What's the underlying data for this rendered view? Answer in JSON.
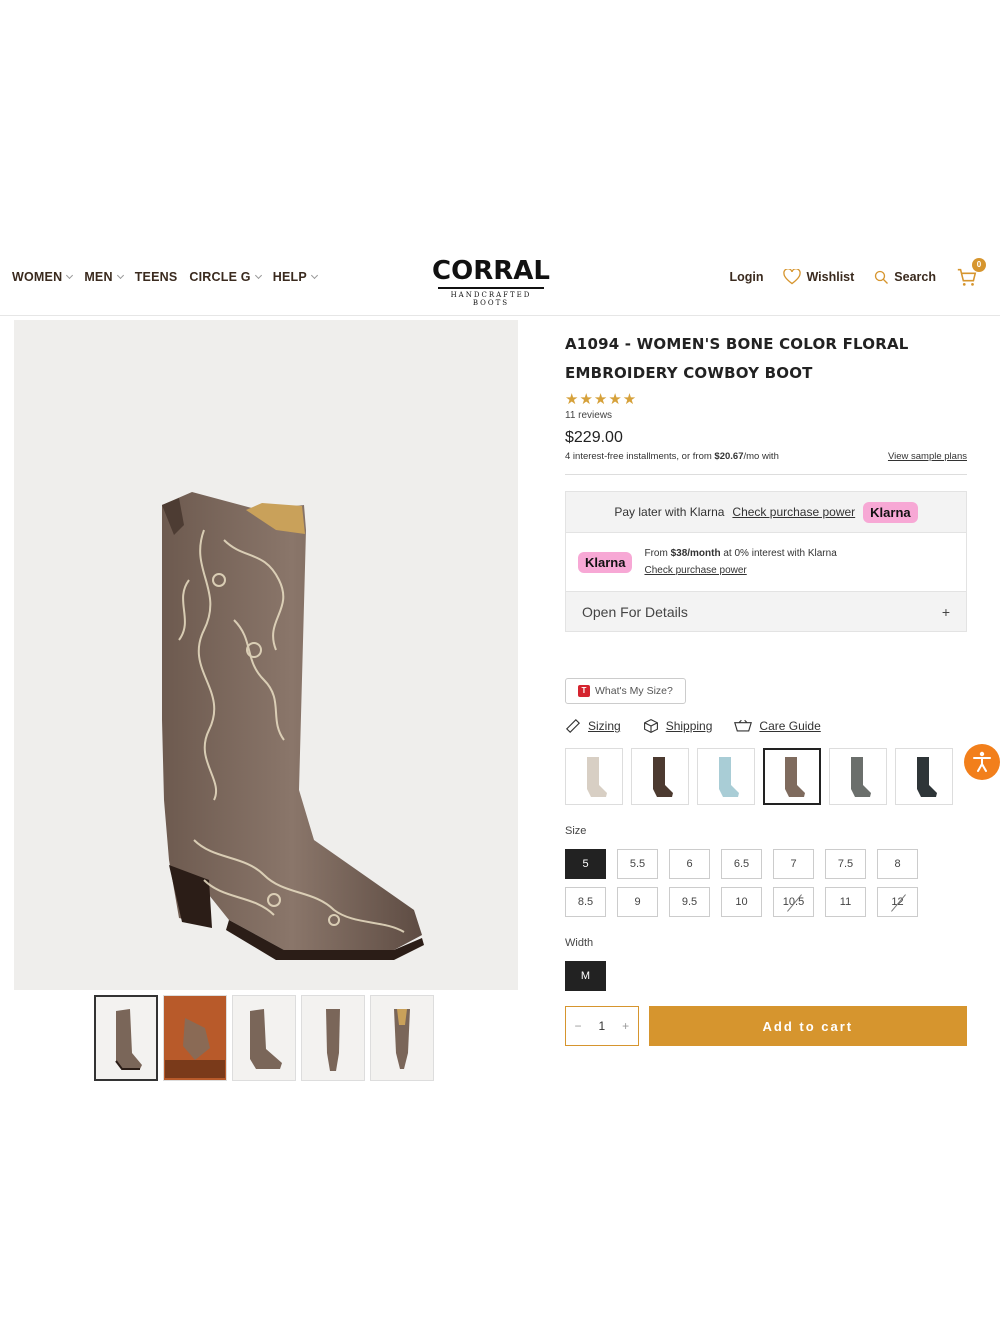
{
  "nav": {
    "items": [
      {
        "label": "WOMEN",
        "has_menu": true
      },
      {
        "label": "MEN",
        "has_menu": true
      },
      {
        "label": "TEENS",
        "has_menu": false
      },
      {
        "label": "CIRCLE G",
        "has_menu": true
      },
      {
        "label": "HELP",
        "has_menu": true
      }
    ]
  },
  "brand": {
    "name": "CORRAL",
    "tagline": "HANDCRAFTED BOOTS"
  },
  "utility": {
    "login": "Login",
    "wishlist": "Wishlist",
    "search": "Search",
    "cart_count": "0"
  },
  "product": {
    "title_line1": "A1094 - WOMEN'S BONE COLOR FLORAL",
    "title_line2": "EMBROIDERY COWBOY BOOT",
    "rating": 5,
    "stars": "★★★★★",
    "reviews": "11 reviews",
    "price": "$229.00",
    "installments_prefix": "4 interest-free installments, or from ",
    "installments_amount": "$20.67",
    "installments_suffix": "/mo with",
    "view_plans": "View sample plans"
  },
  "klarna": {
    "pay_later": "Pay later with Klarna",
    "check_power": "Check purchase power",
    "badge": "Klarna",
    "from_prefix": "From ",
    "from_amount": "$38/month",
    "from_suffix": " at 0% interest with Klarna",
    "check_power_2": "Check purchase power",
    "open_details": "Open For Details",
    "open_icon": "+"
  },
  "fit": {
    "whats_my_size": "What's My Size?",
    "links": [
      {
        "label": "Sizing",
        "icon": "ruler-icon"
      },
      {
        "label": "Shipping",
        "icon": "box-icon"
      },
      {
        "label": "Care Guide",
        "icon": "basket-icon"
      }
    ]
  },
  "colors": {
    "accent": "#d6952e",
    "klarna_pink": "#f7a8d5",
    "selected_swatch_index": 3,
    "swatches": [
      "bone",
      "dark-brown",
      "light-blue",
      "brown-crackle",
      "grey",
      "black"
    ]
  },
  "size": {
    "label": "Size",
    "options": [
      {
        "value": "5",
        "state": "selected"
      },
      {
        "value": "5.5",
        "state": "available"
      },
      {
        "value": "6",
        "state": "available"
      },
      {
        "value": "6.5",
        "state": "available"
      },
      {
        "value": "7",
        "state": "available"
      },
      {
        "value": "7.5",
        "state": "available"
      },
      {
        "value": "8",
        "state": "available"
      },
      {
        "value": "8.5",
        "state": "available"
      },
      {
        "value": "9",
        "state": "available"
      },
      {
        "value": "9.5",
        "state": "available"
      },
      {
        "value": "10",
        "state": "available"
      },
      {
        "value": "10.5",
        "state": "unavailable"
      },
      {
        "value": "11",
        "state": "available"
      },
      {
        "value": "12",
        "state": "unavailable"
      }
    ]
  },
  "width": {
    "label": "Width",
    "selected": "M"
  },
  "cart": {
    "qty_minus": "−",
    "qty": "1",
    "qty_plus": "+",
    "add_label": "Add to cart"
  },
  "gallery": {
    "thumb_count": 5,
    "active_index": 0
  }
}
